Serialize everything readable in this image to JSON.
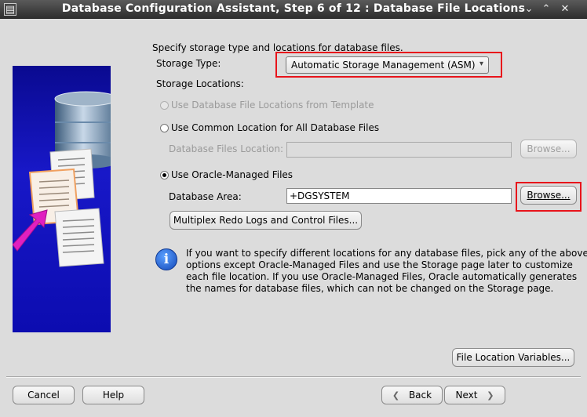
{
  "window": {
    "title": "Database Configuration Assistant, Step 6 of 12 : Database File Locations",
    "minimize": "⌄",
    "maximize": "⌃",
    "close": "✕"
  },
  "intro": "Specify storage type and locations for database files.",
  "storage_type": {
    "label": "Storage Type:",
    "selected": "Automatic Storage Management (ASM)"
  },
  "storage_locations": {
    "label": "Storage Locations:",
    "options": [
      {
        "label": "Use Database File Locations from Template",
        "checked": false,
        "enabled": false
      },
      {
        "label": "Use Common Location for All Database Files",
        "checked": false,
        "enabled": true
      },
      {
        "label": "Use Oracle-Managed Files",
        "checked": true,
        "enabled": true
      }
    ],
    "db_files_location": {
      "label": "Database Files Location:",
      "value": "",
      "browse": "Browse..."
    },
    "db_area": {
      "label": "Database Area:",
      "value": "+DGSYSTEM",
      "browse": "Browse..."
    },
    "multiplex_button": "Multiplex Redo Logs and Control Files..."
  },
  "info": {
    "lines": [
      "If you want to specify different locations for any database files, pick any of the above",
      "options except Oracle-Managed Files and use the Storage page later to customize",
      "each file location. If you use Oracle-Managed Files, Oracle automatically generates",
      "the names for database files, which can not be changed on the Storage page."
    ]
  },
  "file_location_variables_button": "File Location Variables...",
  "footer": {
    "cancel": "Cancel",
    "help": "Help",
    "back": "Back",
    "next": "Next"
  },
  "colors": {
    "highlight_box": "#e8141b",
    "side_panel": "#1818c8",
    "arrow": "#e020c0"
  }
}
